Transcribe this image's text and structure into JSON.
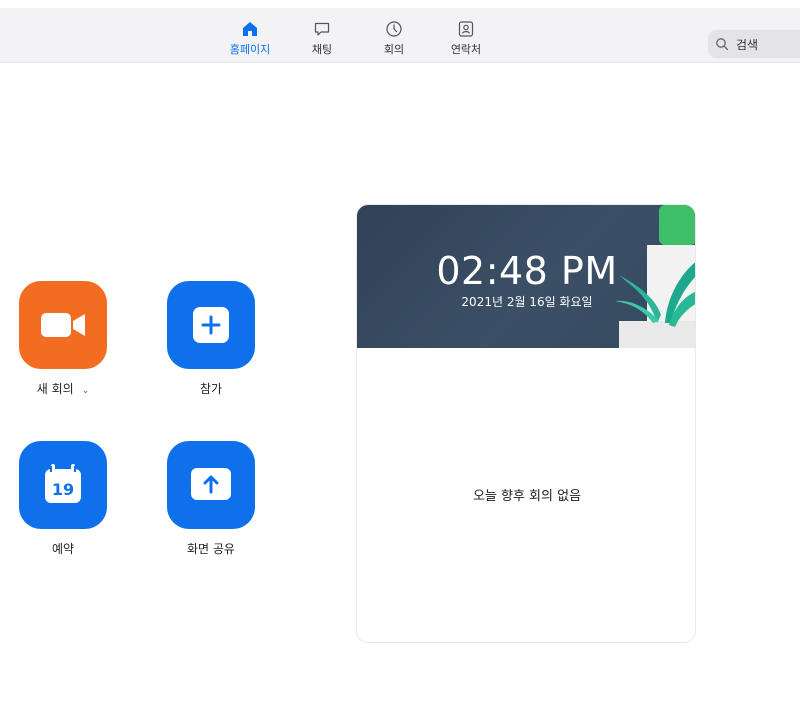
{
  "nav": {
    "tabs": [
      {
        "label": "홈페이지",
        "icon": "home-icon",
        "active": true
      },
      {
        "label": "채팅",
        "icon": "chat-bubble-icon",
        "active": false
      },
      {
        "label": "회의",
        "icon": "clock-icon",
        "active": false
      },
      {
        "label": "연락처",
        "icon": "contact-card-icon",
        "active": false
      }
    ],
    "search_label": "검색"
  },
  "actions": [
    {
      "label": "새 회의",
      "icon": "video-camera-icon",
      "color": "#f26d21",
      "has_dropdown": true
    },
    {
      "label": "참가",
      "icon": "plus-icon",
      "color": "#0e71eb"
    },
    {
      "label": "예약",
      "icon": "calendar-icon",
      "icon_text": "19",
      "color": "#0e71eb"
    },
    {
      "label": "화면 공유",
      "icon": "upload-arrow-icon",
      "color": "#0e71eb"
    }
  ],
  "meeting_card": {
    "time": "02:48 PM",
    "date": "2021년 2월 16일 화요일",
    "empty_text": "오늘 향후 회의 없음"
  },
  "colors": {
    "accent": "#0e71eb",
    "new_meeting": "#f26d21",
    "banner": "#34485e"
  }
}
